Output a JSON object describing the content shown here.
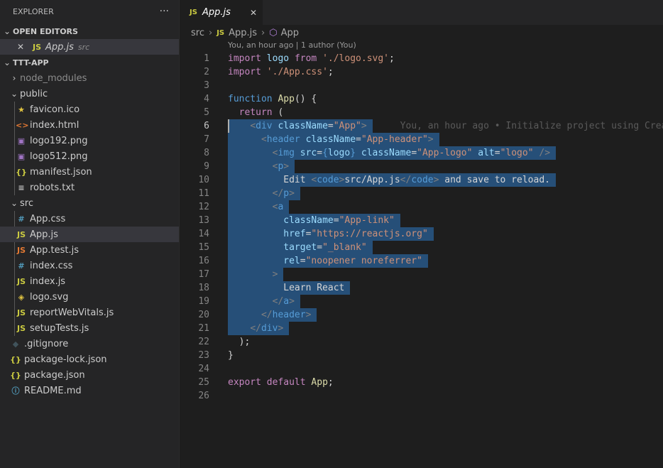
{
  "explorer": {
    "title": "EXPLORER",
    "more": "···",
    "open_editors": {
      "title": "OPEN EDITORS",
      "item": {
        "close": "✕",
        "icon": "JS",
        "name": "App.js",
        "folder": "src"
      }
    },
    "project": {
      "title": "TTT-APP"
    },
    "tree": [
      {
        "name": "node_modules",
        "kind": "folder",
        "chev": "›"
      },
      {
        "name": "public",
        "kind": "folder",
        "chev": "⌄"
      },
      {
        "name": "favicon.ico",
        "icon": "★",
        "icon_color": "#e2c541"
      },
      {
        "name": "index.html",
        "icon": "<>",
        "icon_color": "#e37933"
      },
      {
        "name": "logo192.png",
        "icon": "▣",
        "icon_color": "#a074c4"
      },
      {
        "name": "logo512.png",
        "icon": "▣",
        "icon_color": "#a074c4"
      },
      {
        "name": "manifest.json",
        "icon": "{}",
        "icon_color": "#cbcb41"
      },
      {
        "name": "robots.txt",
        "icon": "≡",
        "icon_color": "#c5c5c5"
      },
      {
        "name": "src",
        "kind": "folder",
        "chev": "⌄"
      },
      {
        "name": "App.css",
        "icon": "#",
        "icon_color": "#519aba"
      },
      {
        "name": "App.js",
        "icon": "JS",
        "icon_color": "#cbcb41",
        "selected": true
      },
      {
        "name": "App.test.js",
        "icon": "JS",
        "icon_color": "#e37933"
      },
      {
        "name": "index.css",
        "icon": "#",
        "icon_color": "#519aba"
      },
      {
        "name": "index.js",
        "icon": "JS",
        "icon_color": "#cbcb41"
      },
      {
        "name": "logo.svg",
        "icon": "◈",
        "icon_color": "#e2c541"
      },
      {
        "name": "reportWebVitals.js",
        "icon": "JS",
        "icon_color": "#cbcb41"
      },
      {
        "name": "setupTests.js",
        "icon": "JS",
        "icon_color": "#cbcb41"
      },
      {
        "name": ".gitignore",
        "icon": "◆",
        "icon_color": "#41535b"
      },
      {
        "name": "package-lock.json",
        "icon": "{}",
        "icon_color": "#cbcb41"
      },
      {
        "name": "package.json",
        "icon": "{}",
        "icon_color": "#cbcb41"
      },
      {
        "name": "README.md",
        "icon": "ⓘ",
        "icon_color": "#519aba"
      }
    ]
  },
  "tab": {
    "icon": "JS",
    "name": "App.js",
    "close": "✕"
  },
  "breadcrumb": {
    "folder": "src",
    "file_icon": "JS",
    "file": "App.js",
    "symbol_icon": "⬡",
    "symbol": "App"
  },
  "blame_header": "You, an hour ago | 1 author (You)",
  "inline_blame": "You, an hour ago • Initialize project using Create React App",
  "current_line": 6,
  "code": [
    {
      "n": "1",
      "tokens": [
        [
          "k",
          "import"
        ],
        [
          "txt",
          " "
        ],
        [
          "id",
          "logo"
        ],
        [
          "txt",
          " "
        ],
        [
          "k",
          "from"
        ],
        [
          "txt",
          " "
        ],
        [
          "s",
          "'./logo.svg'"
        ],
        [
          "txt",
          ";"
        ]
      ]
    },
    {
      "n": "2",
      "tokens": [
        [
          "k",
          "import"
        ],
        [
          "txt",
          " "
        ],
        [
          "s",
          "'./App.css'"
        ],
        [
          "txt",
          ";"
        ]
      ]
    },
    {
      "n": "3",
      "tokens": []
    },
    {
      "n": "4",
      "tokens": [
        [
          "kb",
          "function"
        ],
        [
          "txt",
          " "
        ],
        [
          "f",
          "App"
        ],
        [
          "txt",
          "() {"
        ]
      ]
    },
    {
      "n": "5",
      "tokens": [
        [
          "txt",
          "  "
        ],
        [
          "k",
          "return"
        ],
        [
          "txt",
          " ("
        ]
      ]
    },
    {
      "n": "6",
      "tokens": [
        [
          "txt",
          "    "
        ],
        [
          "tg",
          "<"
        ],
        [
          "t",
          "div"
        ],
        [
          "txt",
          " "
        ],
        [
          "a",
          "className"
        ],
        [
          "txt",
          "="
        ],
        [
          "s",
          "\"App\""
        ],
        [
          "tg",
          ">"
        ]
      ]
    },
    {
      "n": "7",
      "tokens": [
        [
          "txt",
          "      "
        ],
        [
          "tg",
          "<"
        ],
        [
          "t",
          "header"
        ],
        [
          "txt",
          " "
        ],
        [
          "a",
          "className"
        ],
        [
          "txt",
          "="
        ],
        [
          "s",
          "\"App-header\""
        ],
        [
          "tg",
          ">"
        ]
      ]
    },
    {
      "n": "8",
      "tokens": [
        [
          "txt",
          "        "
        ],
        [
          "tg",
          "<"
        ],
        [
          "t",
          "img"
        ],
        [
          "txt",
          " "
        ],
        [
          "a",
          "src"
        ],
        [
          "txt",
          "="
        ],
        [
          "kb",
          "{"
        ],
        [
          "id",
          "logo"
        ],
        [
          "kb",
          "}"
        ],
        [
          "txt",
          " "
        ],
        [
          "a",
          "className"
        ],
        [
          "txt",
          "="
        ],
        [
          "s",
          "\"App-logo\""
        ],
        [
          "txt",
          " "
        ],
        [
          "a",
          "alt"
        ],
        [
          "txt",
          "="
        ],
        [
          "s",
          "\"logo\""
        ],
        [
          "txt",
          " "
        ],
        [
          "tg",
          "/>"
        ]
      ]
    },
    {
      "n": "9",
      "tokens": [
        [
          "txt",
          "        "
        ],
        [
          "tg",
          "<"
        ],
        [
          "t",
          "p"
        ],
        [
          "tg",
          ">"
        ]
      ]
    },
    {
      "n": "10",
      "tokens": [
        [
          "txt",
          "          Edit "
        ],
        [
          "tg",
          "<"
        ],
        [
          "t",
          "code"
        ],
        [
          "tg",
          ">"
        ],
        [
          "txt",
          "src/App.js"
        ],
        [
          "tg",
          "</"
        ],
        [
          "t",
          "code"
        ],
        [
          "tg",
          ">"
        ],
        [
          "txt",
          " and save to reload."
        ]
      ]
    },
    {
      "n": "11",
      "tokens": [
        [
          "txt",
          "        "
        ],
        [
          "tg",
          "</"
        ],
        [
          "t",
          "p"
        ],
        [
          "tg",
          ">"
        ]
      ]
    },
    {
      "n": "12",
      "tokens": [
        [
          "txt",
          "        "
        ],
        [
          "tg",
          "<"
        ],
        [
          "t",
          "a"
        ]
      ]
    },
    {
      "n": "13",
      "tokens": [
        [
          "txt",
          "          "
        ],
        [
          "a",
          "className"
        ],
        [
          "txt",
          "="
        ],
        [
          "s",
          "\"App-link\""
        ]
      ]
    },
    {
      "n": "14",
      "tokens": [
        [
          "txt",
          "          "
        ],
        [
          "a",
          "href"
        ],
        [
          "txt",
          "="
        ],
        [
          "s",
          "\"https://reactjs.org\""
        ]
      ]
    },
    {
      "n": "15",
      "tokens": [
        [
          "txt",
          "          "
        ],
        [
          "a",
          "target"
        ],
        [
          "txt",
          "="
        ],
        [
          "s",
          "\"_blank\""
        ]
      ]
    },
    {
      "n": "16",
      "tokens": [
        [
          "txt",
          "          "
        ],
        [
          "a",
          "rel"
        ],
        [
          "txt",
          "="
        ],
        [
          "s",
          "\"noopener noreferrer\""
        ]
      ]
    },
    {
      "n": "17",
      "tokens": [
        [
          "txt",
          "        "
        ],
        [
          "tg",
          ">"
        ]
      ]
    },
    {
      "n": "18",
      "tokens": [
        [
          "txt",
          "          Learn React"
        ]
      ]
    },
    {
      "n": "19",
      "tokens": [
        [
          "txt",
          "        "
        ],
        [
          "tg",
          "</"
        ],
        [
          "t",
          "a"
        ],
        [
          "tg",
          ">"
        ]
      ]
    },
    {
      "n": "20",
      "tokens": [
        [
          "txt",
          "      "
        ],
        [
          "tg",
          "</"
        ],
        [
          "t",
          "header"
        ],
        [
          "tg",
          ">"
        ]
      ]
    },
    {
      "n": "21",
      "tokens": [
        [
          "txt",
          "    "
        ],
        [
          "tg",
          "</"
        ],
        [
          "t",
          "div"
        ],
        [
          "tg",
          ">"
        ]
      ]
    },
    {
      "n": "22",
      "tokens": [
        [
          "txt",
          "  );"
        ]
      ]
    },
    {
      "n": "23",
      "tokens": [
        [
          "txt",
          "}"
        ]
      ]
    },
    {
      "n": "24",
      "tokens": []
    },
    {
      "n": "25",
      "tokens": [
        [
          "k",
          "export"
        ],
        [
          "txt",
          " "
        ],
        [
          "k",
          "default"
        ],
        [
          "txt",
          " "
        ],
        [
          "f",
          "App"
        ],
        [
          "txt",
          ";"
        ]
      ]
    },
    {
      "n": "26",
      "tokens": []
    }
  ],
  "colors": {
    "selection": "#264f78",
    "sidebar": "#252526",
    "editor": "#1e1e1e",
    "accent": "#cbcb41"
  }
}
